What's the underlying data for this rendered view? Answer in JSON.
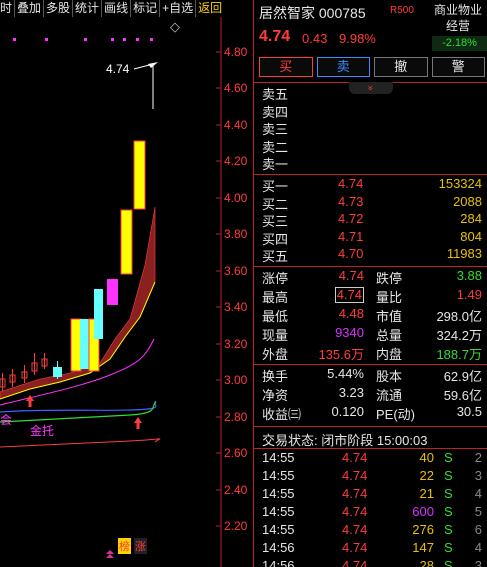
{
  "toolbar": {
    "items": [
      "时",
      "叠加",
      "多股",
      "统计",
      "画线",
      "标记",
      "+自选",
      "返回"
    ]
  },
  "chart": {
    "y_ticks": [
      "4.80",
      "4.60",
      "4.40",
      "4.20",
      "4.00",
      "3.80",
      "3.60",
      "3.40",
      "3.20",
      "3.00",
      "2.80",
      "2.60",
      "2.40",
      "2.20"
    ],
    "high_marker": "4.74",
    "label_hui": "会",
    "label_jintuo": "金托",
    "label_bang": "榜",
    "label_zhang": "涨",
    "diamond": "◇",
    "colors": {
      "up": "#ff3c3c",
      "fill_up": "#ffff00",
      "cyan": "#66ffff",
      "magenta": "#ff33ff",
      "band": "#8b2020"
    }
  },
  "header": {
    "name_code": "居然智家 000785",
    "r_badge": "R500",
    "industry": "商业物业经营",
    "industry_pct": "-2.18%",
    "price": "4.74",
    "change": "0.43",
    "change_pct": "9.98%"
  },
  "actions": {
    "buy": "买",
    "sell": "卖",
    "cancel": "撤",
    "alert": "警"
  },
  "collapse_glyph": "»",
  "ask_book": [
    {
      "label": "卖五",
      "price": "",
      "volume": ""
    },
    {
      "label": "卖四",
      "price": "",
      "volume": ""
    },
    {
      "label": "卖三",
      "price": "",
      "volume": ""
    },
    {
      "label": "卖二",
      "price": "",
      "volume": ""
    },
    {
      "label": "卖一",
      "price": "",
      "volume": ""
    }
  ],
  "bid_book": [
    {
      "label": "买一",
      "price": "4.74",
      "volume": "153324"
    },
    {
      "label": "买二",
      "price": "4.73",
      "volume": "2088"
    },
    {
      "label": "买三",
      "price": "4.72",
      "volume": "284"
    },
    {
      "label": "买四",
      "price": "4.71",
      "volume": "804"
    },
    {
      "label": "买五",
      "price": "4.70",
      "volume": "11983"
    }
  ],
  "stats": {
    "limit_up_label": "涨停",
    "limit_up": "4.74",
    "limit_down_label": "跌停",
    "limit_down": "3.88",
    "high_label": "最高",
    "high": "4.74",
    "vol_ratio_label": "量比",
    "vol_ratio": "1.49",
    "low_label": "最低",
    "low": "4.48",
    "mkt_cap_label": "市值",
    "mkt_cap": "298.0亿",
    "now_vol_label": "现量",
    "now_vol": "9340",
    "total_vol_label": "总量",
    "total_vol": "324.2万",
    "outer_label": "外盘",
    "outer": "135.6万",
    "inner_label": "内盘",
    "inner": "188.7万"
  },
  "stats2": {
    "turnover_label": "换手",
    "turnover": "5.44%",
    "equity_label": "股本",
    "equity": "62.9亿",
    "nav_label": "净资",
    "nav": "3.23",
    "float_label": "流通",
    "float": "59.6亿",
    "eps_label": "收益㈢",
    "eps": "0.120",
    "pe_label": "PE(动)",
    "pe": "30.5"
  },
  "trade_status": "交易状态: 闭市阶段 15:00:03",
  "trades": [
    {
      "time": "14:55",
      "price": "4.74",
      "volume": "40",
      "dir": "S",
      "idx": "2"
    },
    {
      "time": "14:55",
      "price": "4.74",
      "volume": "22",
      "dir": "S",
      "idx": "3"
    },
    {
      "time": "14:55",
      "price": "4.74",
      "volume": "21",
      "dir": "S",
      "idx": "4"
    },
    {
      "time": "14:55",
      "price": "4.74",
      "volume": "600",
      "dir": "S",
      "idx": "5"
    },
    {
      "time": "14:55",
      "price": "4.74",
      "volume": "276",
      "dir": "S",
      "idx": "6"
    },
    {
      "time": "14:56",
      "price": "4.74",
      "volume": "147",
      "dir": "S",
      "idx": "4"
    },
    {
      "time": "14:56",
      "price": "4.74",
      "volume": "28",
      "dir": "S",
      "idx": "3"
    }
  ]
}
